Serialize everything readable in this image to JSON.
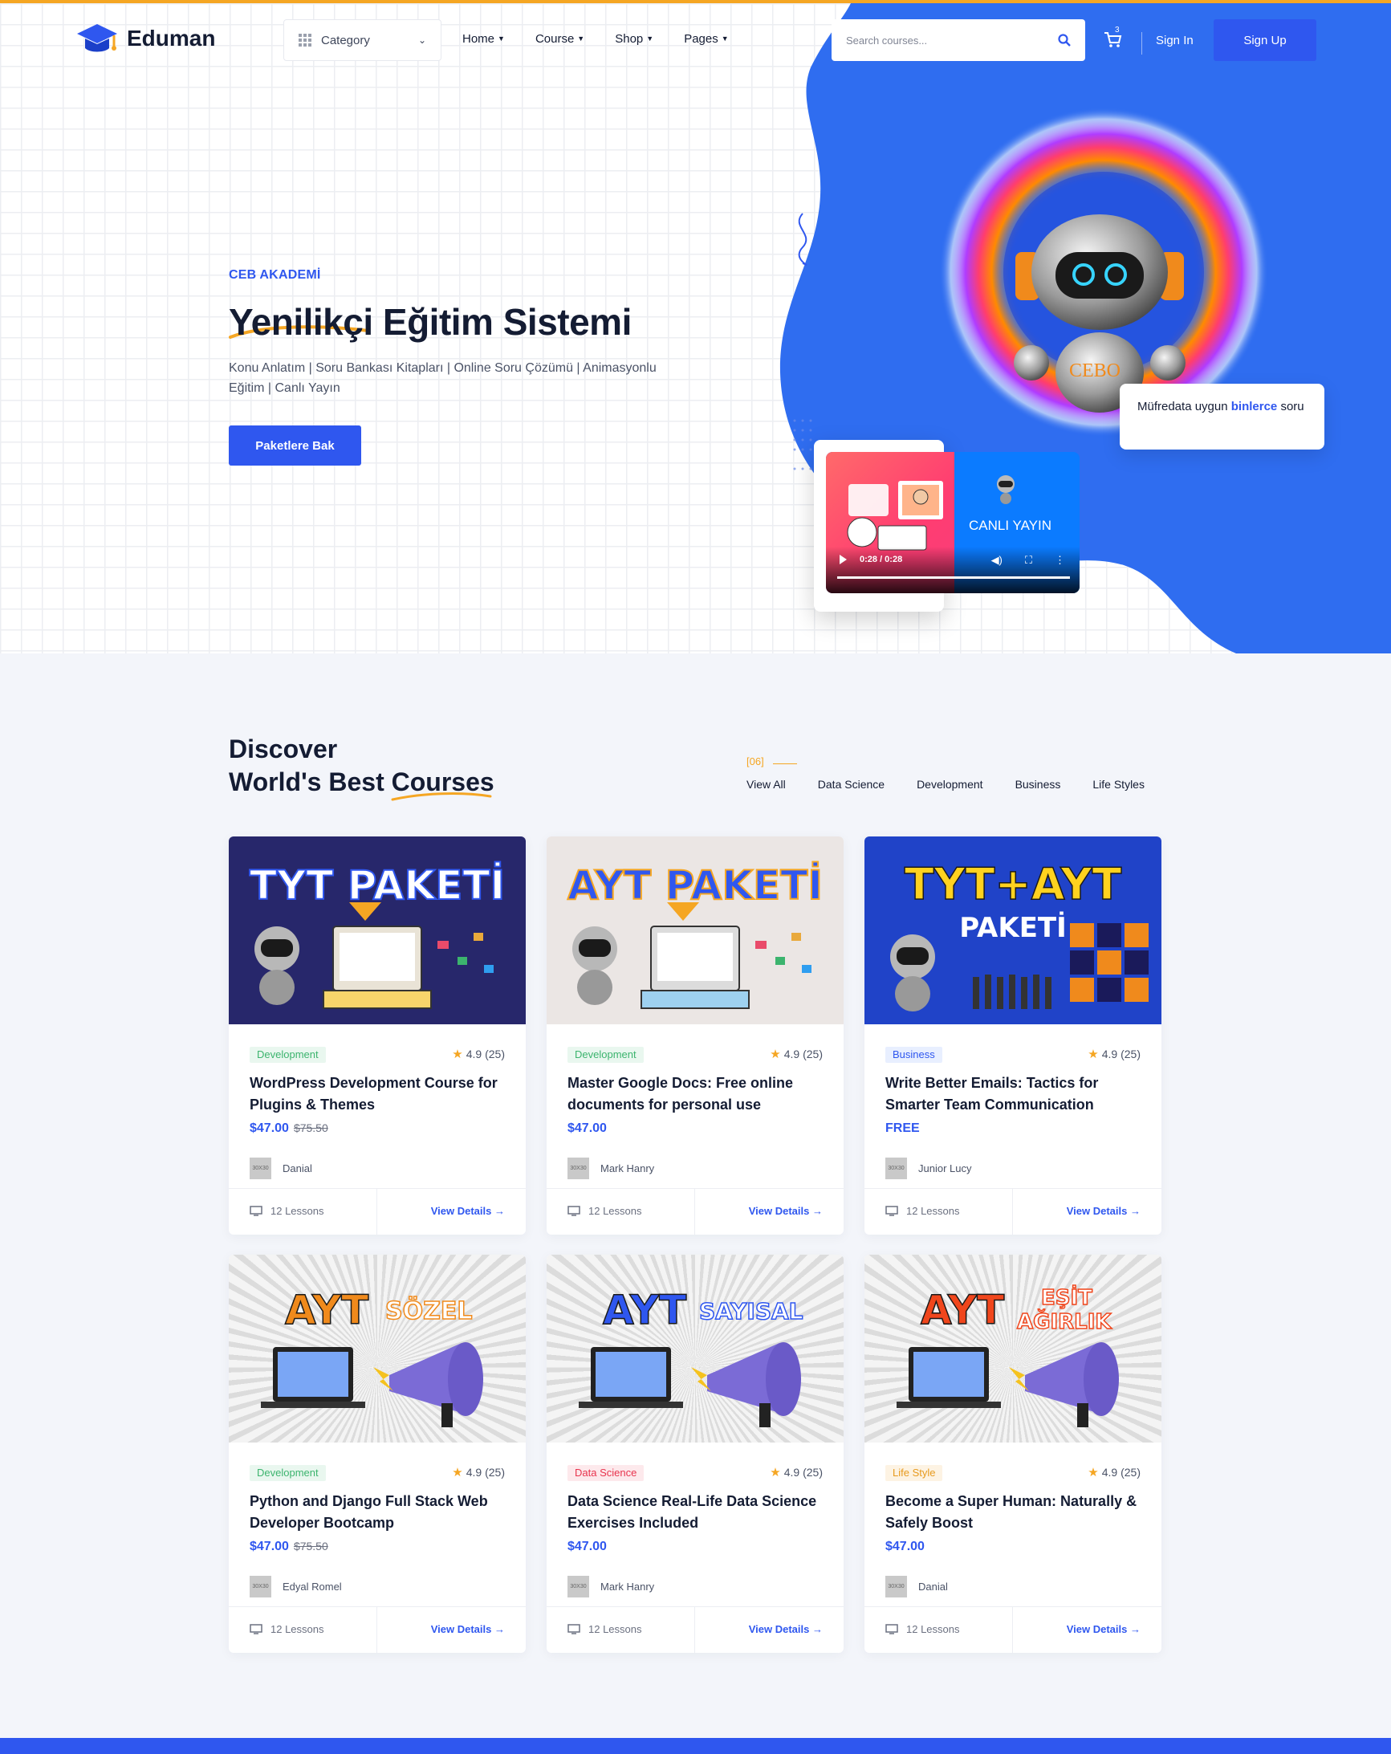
{
  "header": {
    "logo_text": "Eduman",
    "category_label": "Category",
    "nav": [
      {
        "label": "Home"
      },
      {
        "label": "Course"
      },
      {
        "label": "Shop"
      },
      {
        "label": "Pages"
      }
    ],
    "search_placeholder": "Search courses...",
    "cart_count": "3",
    "signin_label": "Sign In",
    "signup_label": "Sign Up"
  },
  "hero": {
    "subtitle": "CEB AKADEMİ",
    "title": "Yenilikçi Eğitim Sistemi",
    "description": "Konu Anlatım | Soru Bankası Kitapları | Online Soru Çözümü | Animasyonlu Eğitim | Canlı Yayın",
    "button_label": "Paketlere Bak",
    "robot_label": "CEBO",
    "info_text_before": "Müfredata uygun ",
    "info_text_bold": "binlerce",
    "info_text_after": " soru",
    "video_title": "CANLI YAYIN",
    "video_time": "0:28 / 0:28"
  },
  "courses_section": {
    "title_line1": "Discover",
    "title_line2": "World's Best Courses",
    "filter_count": "[06]",
    "filters": [
      {
        "label": "View All"
      },
      {
        "label": "Data Science"
      },
      {
        "label": "Development"
      },
      {
        "label": "Business"
      },
      {
        "label": "Life Styles"
      }
    ]
  },
  "courses": [
    {
      "image_title": "TYT PAKETİ",
      "category": "Development",
      "rating": "4.9 (25)",
      "title": "WordPress Development Course for Plugins & Themes",
      "price": "$47.00",
      "old_price": "$75.50",
      "author": "Danial",
      "avatar_text": "30X30",
      "lessons": "12 Lessons",
      "cta": "View Details"
    },
    {
      "image_title": "AYT PAKETİ",
      "category": "Development",
      "rating": "4.9 (25)",
      "title": "Master Google Docs: Free online documents for personal use",
      "price": "$47.00",
      "old_price": "",
      "author": "Mark Hanry",
      "avatar_text": "30X30",
      "lessons": "12 Lessons",
      "cta": "View Details"
    },
    {
      "image_title": "TYT+AYT",
      "image_subtitle": "PAKETİ",
      "category": "Business",
      "rating": "4.9 (25)",
      "title": "Write Better Emails: Tactics for Smarter Team Communication",
      "price": "FREE",
      "old_price": "",
      "author": "Junior Lucy",
      "avatar_text": "30X30",
      "lessons": "12 Lessons",
      "cta": "View Details"
    },
    {
      "image_title": "AYT",
      "image_subtitle": "SÖZEL",
      "category": "Development",
      "rating": "4.9 (25)",
      "title": "Python and Django Full Stack Web Developer Bootcamp",
      "price": "$47.00",
      "old_price": "$75.50",
      "author": "Edyal Romel",
      "avatar_text": "30X30",
      "lessons": "12 Lessons",
      "cta": "View Details"
    },
    {
      "image_title": "AYT",
      "image_subtitle": "SAYISAL",
      "category": "Data Science",
      "rating": "4.9 (25)",
      "title": "Data Science Real-Life Data Science Exercises Included",
      "price": "$47.00",
      "old_price": "",
      "author": "Mark Hanry",
      "avatar_text": "30X30",
      "lessons": "12 Lessons",
      "cta": "View Details"
    },
    {
      "image_title": "AYT",
      "image_subtitle": "EŞİT",
      "image_subtitle2": "AĞIRLIK",
      "category": "Life Style",
      "rating": "4.9 (25)",
      "title": "Become a Super Human: Naturally & Safely Boost",
      "price": "$47.00",
      "old_price": "",
      "author": "Danial",
      "avatar_text": "30X30",
      "lessons": "12 Lessons",
      "cta": "View Details"
    }
  ],
  "colors": {
    "primary": "#2f57ef",
    "accent": "#f5a623",
    "heading": "#141c33"
  }
}
